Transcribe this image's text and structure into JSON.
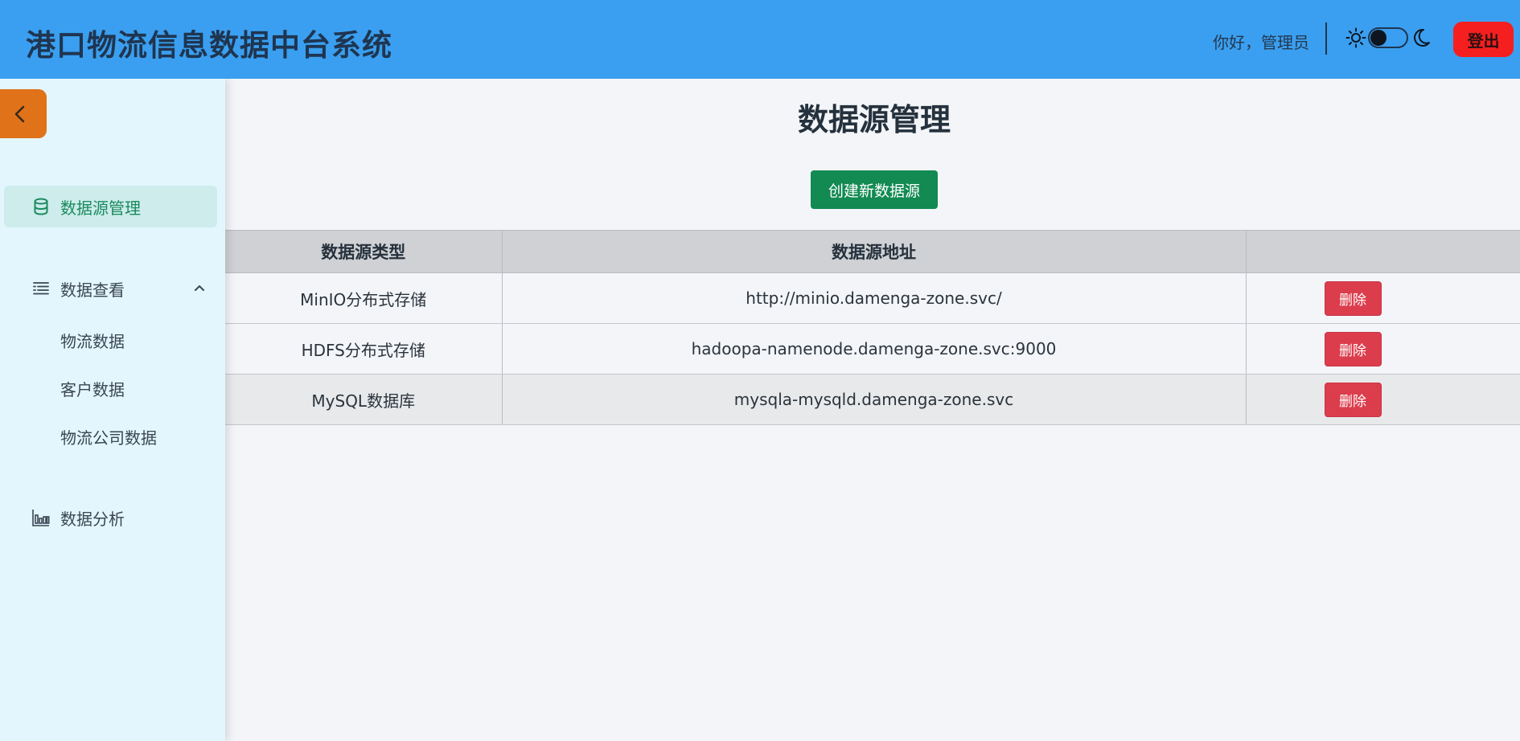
{
  "header": {
    "title": "港口物流信息数据中台系统",
    "greeting": "你好，管理员",
    "logout_label": "登出",
    "sun_icon": "sun-icon",
    "moon_icon": "moon-icon"
  },
  "sidebar": {
    "collapse_icon": "chevron-left-icon",
    "items": [
      {
        "label": "数据源管理",
        "icon": "database-icon",
        "active": true
      },
      {
        "label": "数据查看",
        "icon": "list-icon",
        "expanded": true,
        "children": [
          {
            "label": "物流数据"
          },
          {
            "label": "客户数据"
          },
          {
            "label": "物流公司数据"
          }
        ]
      },
      {
        "label": "数据分析",
        "icon": "bar-chart-icon"
      }
    ]
  },
  "main": {
    "page_title": "数据源管理",
    "create_button": "创建新数据源",
    "table": {
      "headers": [
        "数据源类型",
        "数据源地址",
        ""
      ],
      "rows": [
        {
          "type": "MinIO分布式存储",
          "address": "http://minio.damenga-zone.svc/",
          "action": "删除"
        },
        {
          "type": "HDFS分布式存储",
          "address": "hadoopa-namenode.damenga-zone.svc:9000",
          "action": "删除"
        },
        {
          "type": "MySQL数据库",
          "address": "mysqla-mysqld.damenga-zone.svc",
          "action": "删除"
        }
      ]
    }
  },
  "colors": {
    "header_bg": "#3a9ff0",
    "sidebar_bg": "#e3f6fe",
    "active_accent": "#1a8a5e",
    "create_btn": "#128a52",
    "delete_btn": "#dc3d4c",
    "logout_btn": "#f51f1f",
    "collapse_btn": "#e0721a"
  }
}
